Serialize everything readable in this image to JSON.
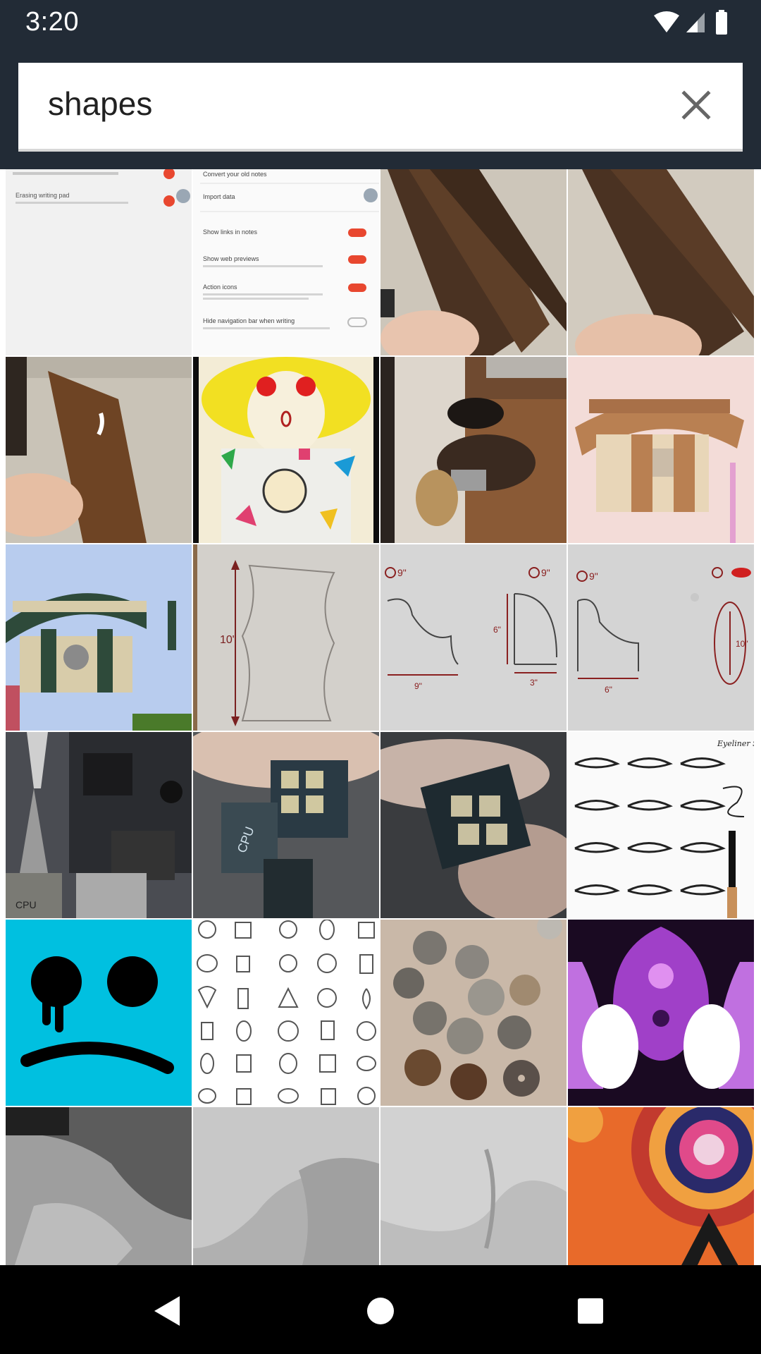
{
  "status_bar": {
    "time": "3:20",
    "icons": [
      "wifi-icon",
      "cellular-signal-icon",
      "battery-icon"
    ]
  },
  "search": {
    "value": "shapes",
    "placeholder": "",
    "clear_icon": "close-icon"
  },
  "results": {
    "columns": 4,
    "thumbnails": [
      {
        "subject": "settings screenshot with toggles",
        "texts": [
          "Erasing writing pad"
        ]
      },
      {
        "subject": "settings screenshot with toggles",
        "texts": [
          "Convert your old notes",
          "Import data",
          "Show links in notes",
          "Show web previews",
          "Action icons",
          "Hide navigation bar when writing"
        ]
      },
      {
        "subject": "hand holding dark wooden boards",
        "texts": []
      },
      {
        "subject": "hand holding dark wooden boards",
        "texts": []
      },
      {
        "subject": "hand holding wooden piece",
        "texts": []
      },
      {
        "subject": "drawing of girl with colorful shapes",
        "texts": []
      },
      {
        "subject": "dogs eating on wooden floor",
        "texts": []
      },
      {
        "subject": "pixel building in brown and cream",
        "texts": []
      },
      {
        "subject": "pixel building under blue sky",
        "texts": []
      },
      {
        "subject": "pencil sketch with measurement",
        "texts": [
          "10\""
        ]
      },
      {
        "subject": "pencil sketch with measurements",
        "texts": [
          "9\"",
          "6\"",
          "3\""
        ]
      },
      {
        "subject": "pencil sketch with measurements",
        "texts": [
          "10\"",
          "6\""
        ]
      },
      {
        "subject": "computer motherboard with cables",
        "texts": [
          "CPU"
        ]
      },
      {
        "subject": "cpu power connector",
        "texts": [
          "CPU"
        ]
      },
      {
        "subject": "power connector pins",
        "texts": []
      },
      {
        "subject": "eyeliner styles chart",
        "texts": [
          "Eyeliner Styles"
        ]
      },
      {
        "subject": "sad face on cyan background",
        "texts": []
      },
      {
        "subject": "gemstone cut shapes chart",
        "texts": []
      },
      {
        "subject": "pile of old coins",
        "texts": []
      },
      {
        "subject": "purple symmetric abstract art",
        "texts": []
      },
      {
        "subject": "white fabric close-up",
        "texts": []
      },
      {
        "subject": "white fabric close-up",
        "texts": []
      },
      {
        "subject": "white fabric close-up",
        "texts": []
      },
      {
        "subject": "colorful concentric circles art",
        "texts": []
      }
    ]
  },
  "navigation": {
    "back_icon": "back-triangle-icon",
    "home_icon": "home-circle-icon",
    "recents_icon": "recents-square-icon"
  },
  "colors": {
    "header_bg": "#222b36",
    "nav_bg": "#000000",
    "search_bg": "#ffffff",
    "toggle_accent": "#e8472f"
  }
}
